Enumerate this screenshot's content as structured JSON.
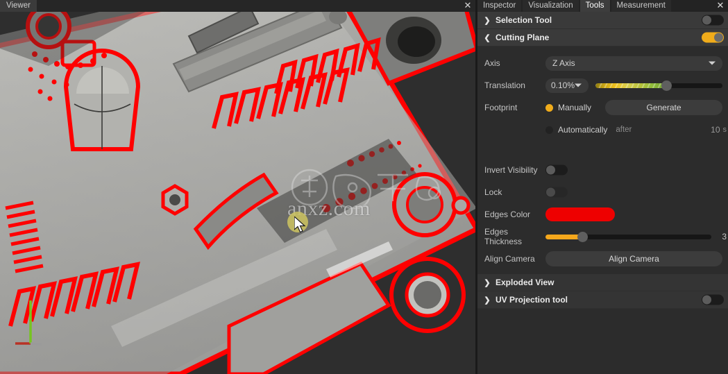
{
  "viewer": {
    "tab_label": "Viewer",
    "close_icon": "close-icon",
    "watermark_text": "anxz.com",
    "gizmo": {
      "x_axis_color": "#b83225",
      "y_axis_color": "#77c420",
      "z_axis_color": "#9a9a9a"
    },
    "model_edge_color": "#ff0000",
    "background_color": "#2e2e2e"
  },
  "panel": {
    "close_icon": "close-icon",
    "tabs": [
      {
        "label": "Inspector",
        "active": false
      },
      {
        "label": "Visualization",
        "active": false
      },
      {
        "label": "Tools",
        "active": true
      },
      {
        "label": "Measurement",
        "active": false
      }
    ],
    "sections": {
      "selection_tool": {
        "title": "Selection Tool",
        "chevron": "chevron-right-icon",
        "toggle_on": false
      },
      "cutting_plane": {
        "title": "Cutting Plane",
        "chevron": "chevron-down-icon",
        "toggle_on": true
      },
      "exploded_view": {
        "title": "Exploded View",
        "chevron": "chevron-right-icon"
      },
      "uv_projection": {
        "title": "UV Projection tool",
        "chevron": "chevron-right-icon",
        "toggle_on": false
      }
    },
    "cutting_plane": {
      "axis": {
        "label": "Axis",
        "value": "Z Axis"
      },
      "translation": {
        "label": "Translation",
        "value": "0.10%",
        "slider_percent": 56
      },
      "footprint": {
        "label": "Footprint",
        "manual_option": "Manually",
        "manual_selected": true,
        "generate_button": "Generate",
        "auto_option": "Automatically",
        "auto_selected": false,
        "after_label": "after",
        "after_value": "10",
        "after_unit": "s"
      },
      "invert_visibility": {
        "label": "Invert Visibility",
        "toggle_on": false
      },
      "lock": {
        "label": "Lock",
        "toggle_on": false
      },
      "edges_color": {
        "label": "Edges Color",
        "color": "#ee0000"
      },
      "edges_thickness": {
        "label": "Edges Thickness",
        "value": "3",
        "slider_percent": 22
      },
      "align_camera": {
        "label": "Align Camera",
        "button": "Align Camera"
      }
    }
  }
}
